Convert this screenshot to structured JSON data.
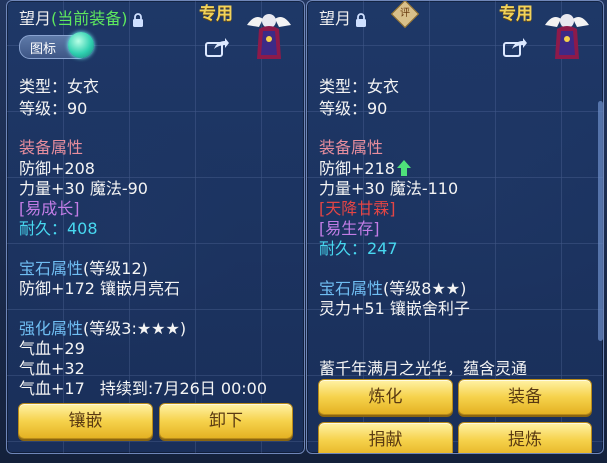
{
  "left": {
    "title_name": "望月",
    "title_status": "(当前装备)",
    "exclusive": "专用",
    "badge_label": "图标",
    "type": "类型：女衣",
    "level": "等级：90",
    "equip_header": "装备属性",
    "defense": "防御+208",
    "str_magic": "力量+30 魔法-90",
    "trait": "[易成长]",
    "durability": "耐久：408",
    "gem_header": "宝石属性",
    "gem_level": "(等级12)",
    "gem_effect": "防御+172 镶嵌月亮石",
    "enhance_header": "强化属性",
    "enhance_level": "(等级3:★★★)",
    "hp1": "气血+29",
    "hp2": "气血+32",
    "hp3": "气血+17",
    "duration": "持续到:7月26日 00:00",
    "buttons": {
      "inlay": "镶嵌",
      "unequip": "卸下"
    }
  },
  "right": {
    "title_name": "望月",
    "seal_char": "评",
    "exclusive": "专用",
    "type": "类型：女衣",
    "level": "等级：90",
    "equip_header": "装备属性",
    "defense": "防御+218",
    "str_magic": "力量+30 魔法-110",
    "special": "[天降甘霖]",
    "trait": "[易生存]",
    "durability": "耐久：247",
    "gem_header": "宝石属性",
    "gem_level": "(等级8★★)",
    "gem_effect": "灵力+51 镶嵌舍利子",
    "flavor": "蓄千年满月之光华，蕴含灵通",
    "buttons": {
      "refine": "炼化",
      "equip": "装备",
      "donate": "捐献",
      "extract": "提炼"
    }
  },
  "colors": {
    "header": "#e68d9d",
    "gem_header": "#6fbdf2",
    "durability": "#48d8f0",
    "trait": "#c27de6",
    "special": "#e34545",
    "current_tag": "#5ee85e",
    "button_gold": "#f6d24c"
  }
}
